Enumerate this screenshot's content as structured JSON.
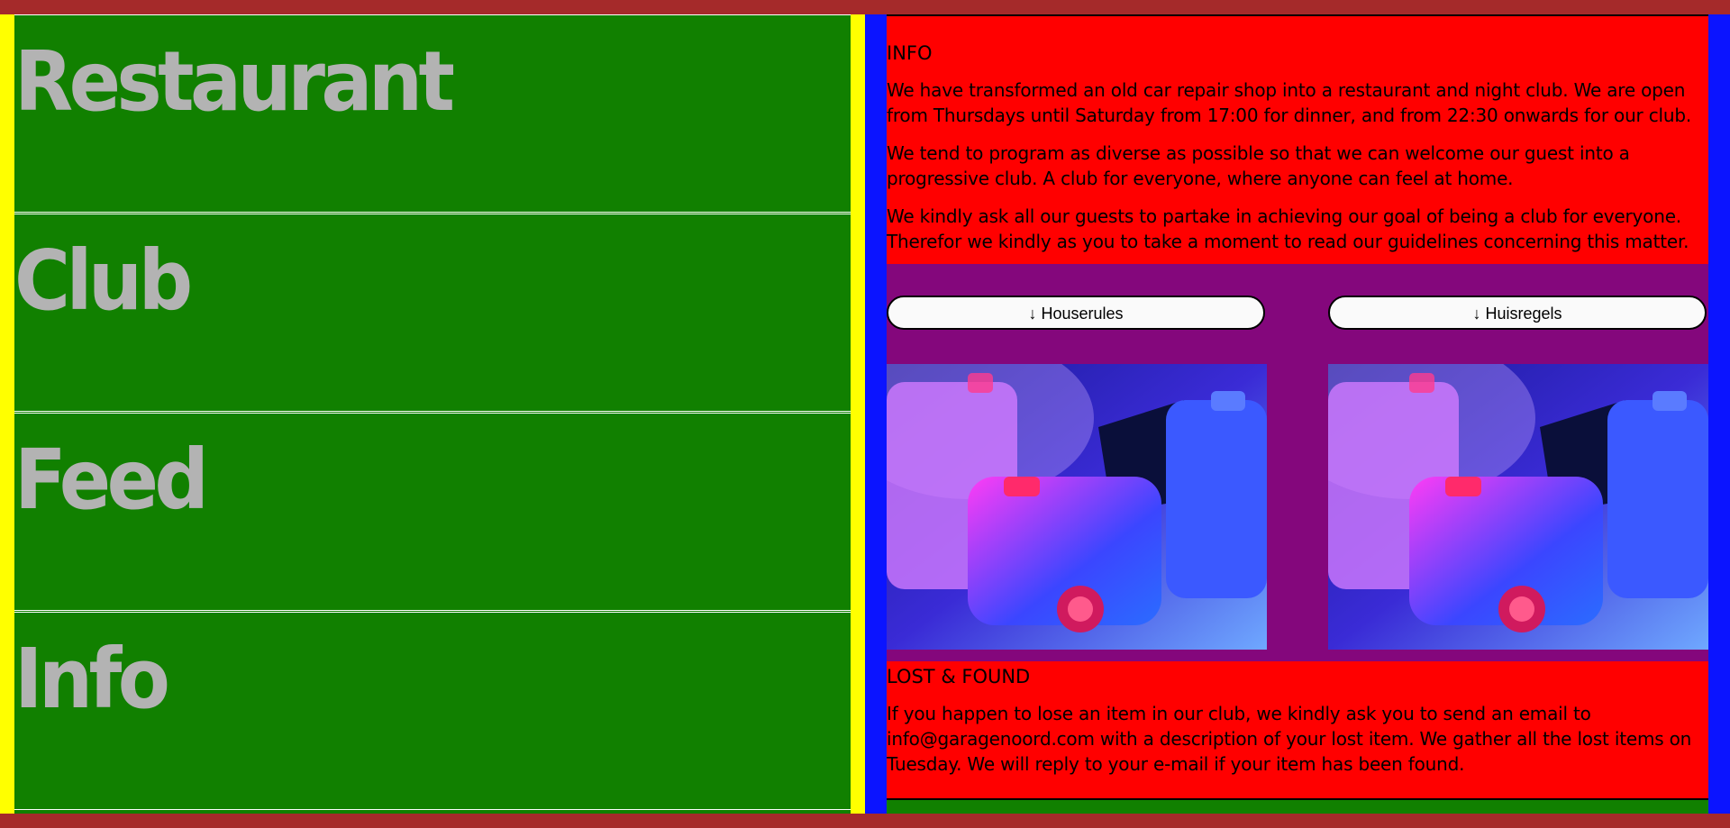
{
  "nav": {
    "items": [
      {
        "label": "Restaurant"
      },
      {
        "label": "Club"
      },
      {
        "label": "Feed"
      },
      {
        "label": "Info"
      }
    ]
  },
  "info": {
    "title": "INFO",
    "paragraphs": [
      "We have transformed an old car repair shop into a restaurant and night club. We are open from Thursdays until Saturday from 17:00 for dinner, and from 22:30 onwards for our club.",
      "We tend to program as diverse as possible so that we can welcome our guest into a progressive club. A club for everyone, where anyone can feel at home.",
      "We kindly ask all our guests to partake in achieving our goal of being a club for everyone. Therefor we kindly as you to take a moment to read our guidelines concerning this matter."
    ]
  },
  "downloads": {
    "houserules_label": "↓ Houserules",
    "huisregels_label": "↓ Huisregels"
  },
  "lost_found": {
    "title": "LOST & FOUND",
    "paragraph": "If you happen to lose an item in our club, we kindly ask you to send an email to info@garagenoord.com with a description of your lost item. We gather all the lost items on Tuesday. We will reply to your e-mail if your item has been found."
  },
  "colors": {
    "page_border": "#a52a2a",
    "left_frame": "#ffff00",
    "nav_bg": "#118000",
    "nav_text": "#b3b3b3",
    "right_frame": "#0b14ff",
    "content_bg": "#ff0000",
    "band_bg": "#84077c"
  }
}
